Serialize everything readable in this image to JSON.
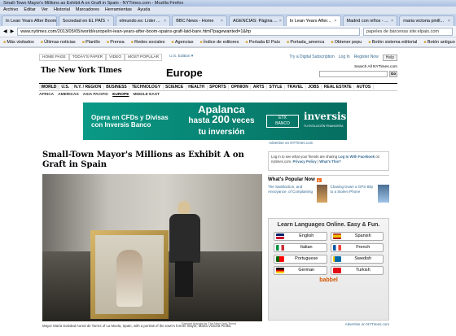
{
  "window": {
    "title": "Small-Town Mayor's Millions as Exhibit A on Graft in Spain - NYTimes.com - Mozilla Firefox"
  },
  "menu": [
    "Archivo",
    "Editar",
    "Ver",
    "Historial",
    "Marcadores",
    "Herramientas",
    "Ayuda"
  ],
  "tabs": [
    {
      "label": "In Lean Years After Boom, Spain's Graft Laid Bare - NYTimes.com - Mozilla Firefox",
      "active": false
    },
    {
      "label": "Sociedad en EL PAÍS",
      "active": false
    },
    {
      "label": "elmundo.es: Líder ...",
      "active": false
    },
    {
      "label": "BBC News - Home",
      "active": false
    },
    {
      "label": "AGENCIAS: Página ...",
      "active": false
    },
    {
      "label": "In Lean Years After...",
      "active": true
    },
    {
      "label": "Madrid con niños - ...",
      "active": false
    },
    {
      "label": "maria victoria pinill...",
      "active": false
    }
  ],
  "nav": {
    "url": "www.nytimes.com/2013/05/05/world/europe/in-lean-years-after-boom-spains-graft-laid-bare.html?pagewanted=1&hp",
    "search": "papeles de bárcenas site:elpais.com"
  },
  "bookmarks": [
    "Más visitados",
    "Últimas noticias",
    "Planillo",
    "Prensa",
    "Redes sociales",
    "Agencias",
    "Índice de editores",
    "Portada El País",
    "Portada_america",
    "Obtener pepu",
    "Botón sistema editorial",
    "Botón antiguo"
  ],
  "nyt": {
    "toplinks": [
      "HOME PAGE",
      "TODAY'S PAPER",
      "VIDEO",
      "MOST POPULAR"
    ],
    "edition": "U.S. Edition ▾",
    "topright": [
      "Try a Digital Subscription",
      "Log In",
      "Register Now",
      "Help"
    ],
    "logo": "The New York Times",
    "section": "Europe",
    "search_label": "Search All NYTimes.com",
    "search_go": "Go",
    "mainnav": [
      "WORLD",
      "U.S.",
      "N.Y. / REGION",
      "BUSINESS",
      "TECHNOLOGY",
      "SCIENCE",
      "HEALTH",
      "SPORTS",
      "OPINION",
      "ARTS",
      "STYLE",
      "TRAVEL",
      "JOBS",
      "REAL ESTATE",
      "AUTOS"
    ],
    "subnav": [
      "AFRICA",
      "AMERICAS",
      "ASIA PACIFIC",
      "EUROPE",
      "MIDDLE EAST"
    ],
    "ad": {
      "left": "Opera en CFDs y Divisas con Inversis Banco",
      "mid_top": "Apalanca",
      "mid_a": "hasta ",
      "mid_num": "200",
      "mid_b": " veces",
      "mid_bottom": "tu inversión",
      "brand_top": "ETX",
      "brand_bottom": "BANCO",
      "brand": "inversis",
      "brand_sub": "TU EVOLUCIÓN FINANCIERA"
    },
    "ad_note": "Advertise on NYTimes.com",
    "headline": "Small-Town Mayor's Millions as Exhibit A on Graft in Spain",
    "photo_credit": "Samuel Aranda for The New York Times",
    "caption": "Mayor María Soledad Aured de Torres of La Muela, Spain, with a portrait of the town's former mayor, María Victoria Pinilla.",
    "login": {
      "text": "Log in to see what your friends are sharing",
      "link": "Log In With Facebook",
      "on": " on nytimes.com.",
      "privacy": "Privacy Policy",
      "whats": "What's This?"
    },
    "popular": {
      "title": "What's Popular Now",
      "items": [
        {
          "text": "The Satisfaction, and Annoyance, of Complaining"
        },
        {
          "text": "Chasing Down a GPS Blip to a Stolen iPhone"
        }
      ]
    },
    "babbel": {
      "title": "Learn Languages Online. Easy & Fun.",
      "langs": [
        {
          "name": "English",
          "c1": "#012169",
          "c2": "#c8102e"
        },
        {
          "name": "Spanish",
          "c1": "#aa151b",
          "c2": "#f1bf00"
        },
        {
          "name": "Italian",
          "c1": "#009246",
          "c2": "#ce2b37"
        },
        {
          "name": "French",
          "c1": "#0055a4",
          "c2": "#ef4135"
        },
        {
          "name": "Portuguese",
          "c1": "#006600",
          "c2": "#ff0000"
        },
        {
          "name": "Swedish",
          "c1": "#006aa7",
          "c2": "#fecc00"
        },
        {
          "name": "German",
          "c1": "#000000",
          "c2": "#dd0000"
        },
        {
          "name": "Turkish",
          "c1": "#e30a17",
          "c2": "#ffffff"
        }
      ],
      "brand": "babbel"
    },
    "side_ad_note": "Advertise on NYTimes.com"
  }
}
